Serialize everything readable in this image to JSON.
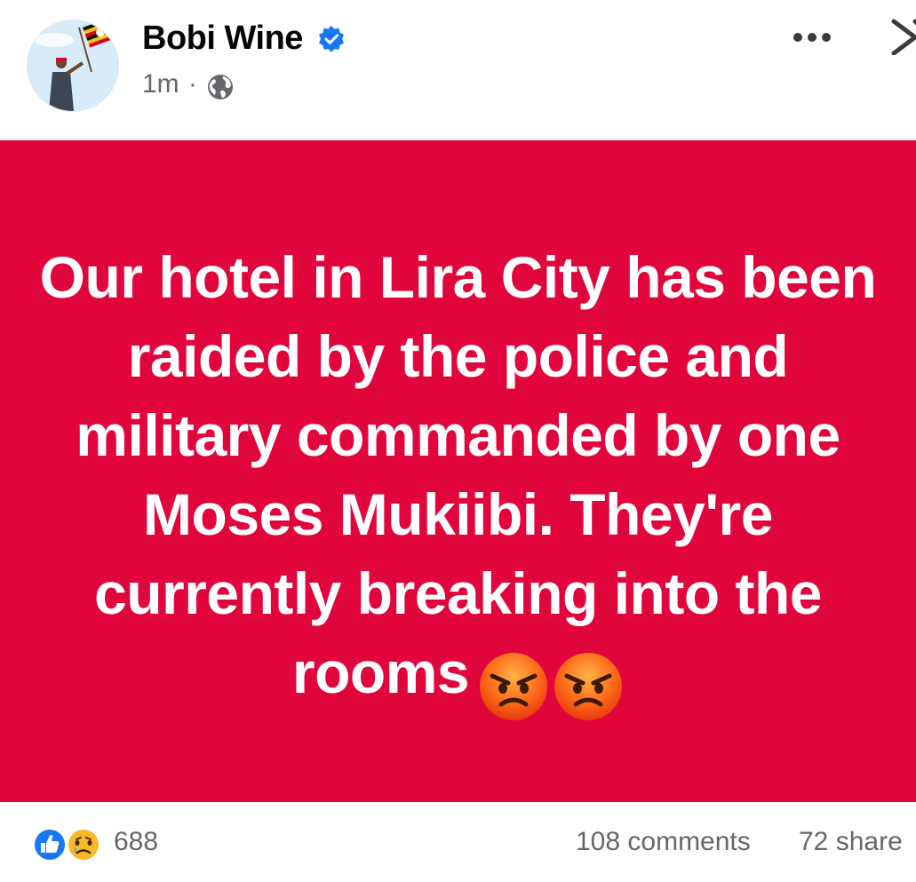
{
  "post": {
    "author_name": "Bobi Wine",
    "verified_icon": "verified-badge-icon",
    "timestamp": "1m",
    "separator": "·",
    "privacy_icon": "globe-icon",
    "more_icon": "more-options-icon",
    "close_icon": "close-icon",
    "background_color": "#e0063c",
    "text_color": "#ffffff",
    "body_text": "Our hotel in Lira City has been raided by the police and military commanded by one Moses Mukiibi. They're currently breaking into  the rooms",
    "trailing_emojis": [
      "angry-face-emoji",
      "angry-face-emoji"
    ]
  },
  "reactions": {
    "icons": [
      "like-icon",
      "sad-face-icon"
    ],
    "count": "688"
  },
  "stats": {
    "comments": "108 comments",
    "shares": "72 share"
  },
  "colors": {
    "facebook_blue": "#1877f2",
    "secondary_text": "#65676b"
  }
}
